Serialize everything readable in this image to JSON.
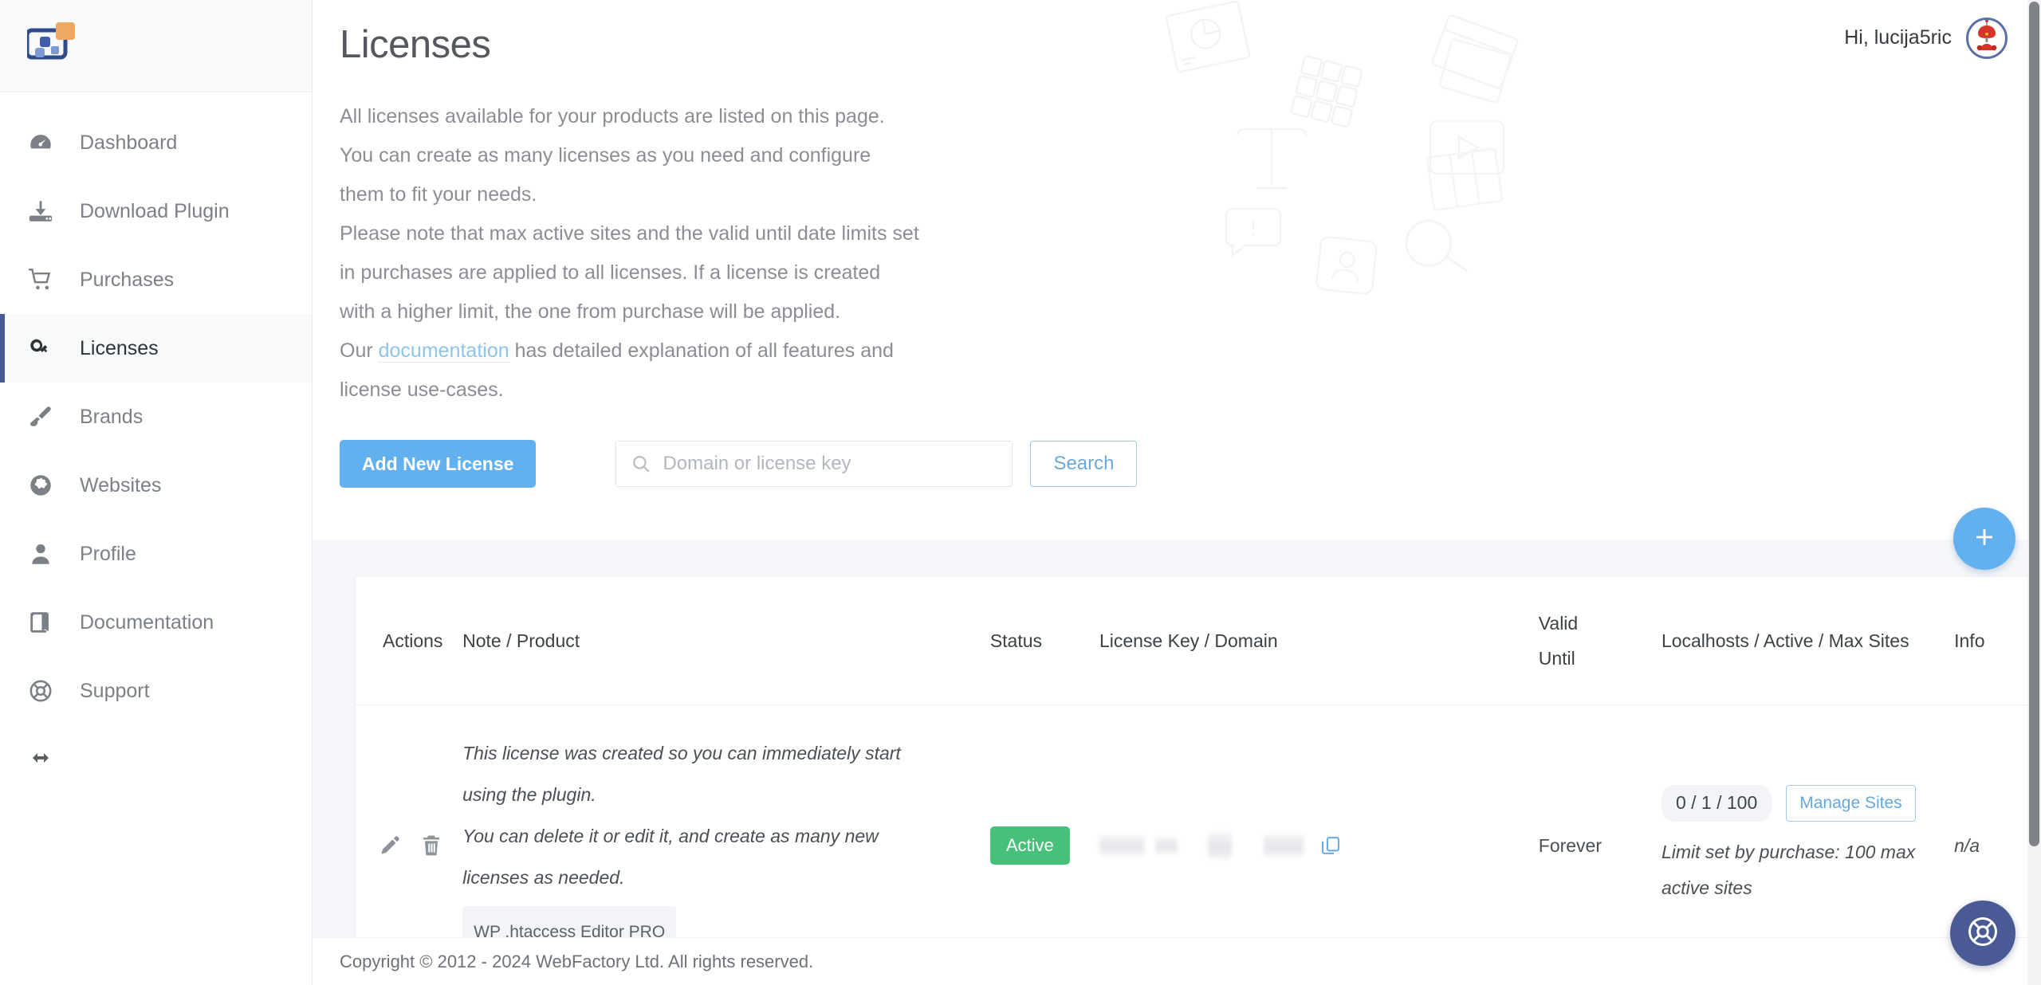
{
  "brand": {
    "logo_icon": "webfactory-logo-icon"
  },
  "sidebar": {
    "items": [
      {
        "label": "Dashboard",
        "icon": "gauge-icon",
        "active": false
      },
      {
        "label": "Download Plugin",
        "icon": "download-icon",
        "active": false
      },
      {
        "label": "Purchases",
        "icon": "shopping-cart-icon",
        "active": false
      },
      {
        "label": "Licenses",
        "icon": "key-icon",
        "active": true
      },
      {
        "label": "Brands",
        "icon": "paintbrush-icon",
        "active": false
      },
      {
        "label": "Websites",
        "icon": "globe-icon",
        "active": false
      },
      {
        "label": "Profile",
        "icon": "user-icon",
        "active": false
      },
      {
        "label": "Documentation",
        "icon": "book-icon",
        "active": false
      },
      {
        "label": "Support",
        "icon": "lifebuoy-icon",
        "active": false
      }
    ],
    "collapse_icon": "arrows-left-right-icon"
  },
  "topbar": {
    "greeting": "Hi, lucija5ric",
    "avatar_icon": "user-avatar-robot-icon"
  },
  "page": {
    "title": "Licenses",
    "intro_lines": [
      "All licenses available for your products are listed on this page.",
      "You can create as many licenses as you need and configure",
      "them to fit your needs.",
      "Please note that max active sites and the valid until date limits set",
      "in purchases are applied to all licenses. If a license is created",
      "with a higher limit, the one from purchase will be applied."
    ],
    "doc_line_prefix": "Our ",
    "doc_link_text": "documentation",
    "doc_line_suffix": " has detailed explanation of all features and",
    "doc_line_last": "license use-cases."
  },
  "toolbar": {
    "add_license_label": "Add New License",
    "search_placeholder": "Domain or license key",
    "search_value": "",
    "search_button_label": "Search",
    "search_icon": "search-icon"
  },
  "table": {
    "columns": [
      {
        "key": "actions",
        "label": "Actions"
      },
      {
        "key": "note",
        "label": "Note / Product"
      },
      {
        "key": "status",
        "label": "Status"
      },
      {
        "key": "license",
        "label": "License Key / Domain"
      },
      {
        "key": "valid",
        "label_line1": "Valid",
        "label_line2": "Until"
      },
      {
        "key": "sites",
        "label": "Localhosts / Active / Max Sites"
      },
      {
        "key": "info",
        "label": "Info"
      }
    ],
    "rows": [
      {
        "actions": {
          "edit_icon": "pencil-icon",
          "delete_icon": "trash-icon"
        },
        "note_lines": [
          "This license was created so you can immediately start",
          "using the plugin.",
          "You can delete it or edit it, and create as many new",
          "licenses as needed."
        ],
        "product": "WP .htaccess Editor PRO",
        "status": "Active",
        "license_key_redacted": true,
        "copy_icon": "copy-icon",
        "valid_until": "Forever",
        "sites_count": "0 / 1 / 100",
        "manage_sites_label": "Manage Sites",
        "limit_note": "Limit set by purchase: 100 max active sites",
        "info": "n/a"
      }
    ]
  },
  "fab": {
    "add_icon": "plus-icon",
    "support_icon": "lifebuoy-icon"
  },
  "footer": {
    "copyright": "Copyright © 2012 - 2024 WebFactory Ltd. All rights reserved."
  },
  "colors": {
    "accent_blue": "#63b0ef",
    "active_green": "#47c07a",
    "sidebar_active_bar": "#4a5a94",
    "support_fab": "#4a5a94",
    "link_blue": "#8ec4e8"
  }
}
